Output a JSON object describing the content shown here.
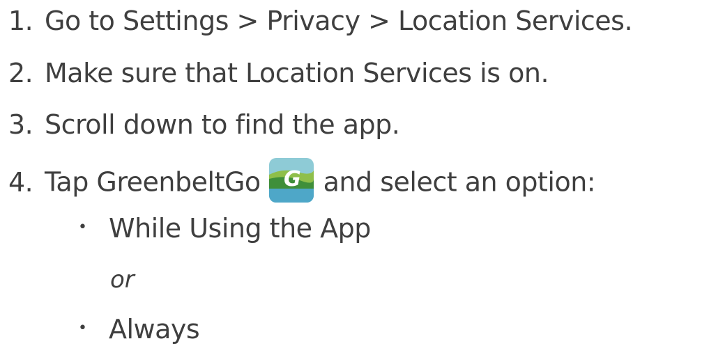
{
  "steps": [
    {
      "number": "1.",
      "text": "Go to Settings > Privacy > Location Services."
    },
    {
      "number": "2.",
      "text": "Make sure that Location Services is on."
    },
    {
      "number": "3.",
      "text": "Scroll down to find the app."
    },
    {
      "number": "4.",
      "text_before": "Tap GreenbeltGo",
      "app_icon": "greenbeltgo-app-icon",
      "app_icon_letter": "G",
      "text_after": "and select an option:"
    }
  ],
  "options": [
    {
      "bullet": "•",
      "text": "While Using the App"
    },
    {
      "bullet": "•",
      "text": "Always"
    }
  ],
  "separator": "or",
  "colors": {
    "text": "#3f3f3f",
    "icon_sky": "#8ecbd6",
    "icon_hill_light": "#8fbf4a",
    "icon_hill_dark": "#3f8f3a",
    "icon_water": "#4ea7c8"
  }
}
